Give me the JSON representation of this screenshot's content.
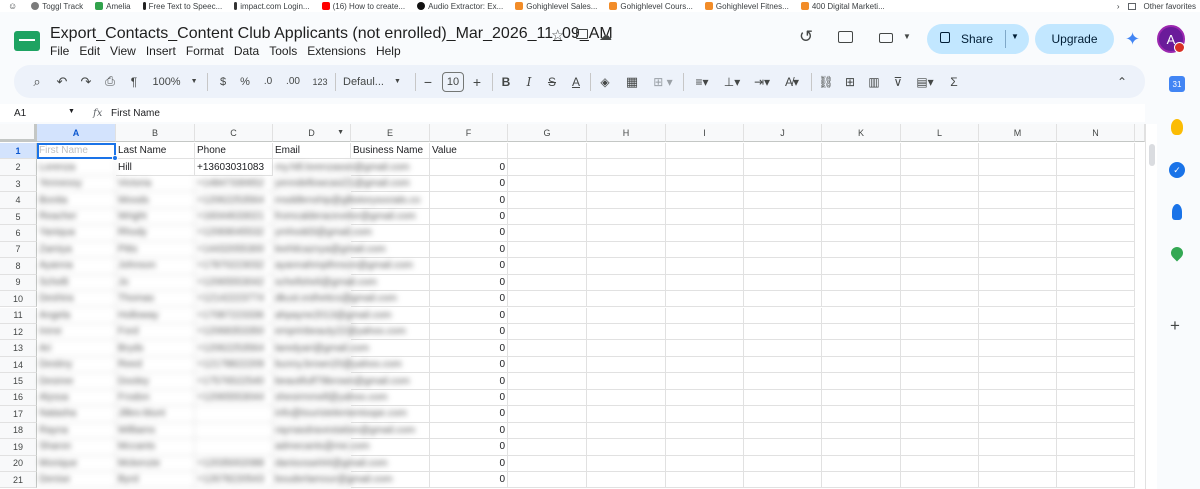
{
  "bookmarks": {
    "items": [
      "Toggl Track",
      "Amelia",
      "Free Text to Speec...",
      "impact.com Login...",
      "(16) How to create...",
      "Audio Extractor: Ex...",
      "Gohighlevel Sales...",
      "Gohighlevel Cours...",
      "Gohighlevel Fitnes...",
      "400 Digital Marketi..."
    ],
    "other_label": "Other favorites"
  },
  "doc": {
    "title": "Export_Contacts_Content Club Applicants (not enrolled)_Mar_2026_11_09_AM"
  },
  "menu": [
    "File",
    "Edit",
    "View",
    "Insert",
    "Format",
    "Data",
    "Tools",
    "Extensions",
    "Help"
  ],
  "header": {
    "share_label": "Share",
    "upgrade_label": "Upgrade",
    "avatar_letter": "A"
  },
  "toolbar": {
    "zoom": "100%",
    "currency": "$",
    "percent": "%",
    "dec_decrease": ".0",
    "dec_increase": ".00",
    "number_format": "123",
    "font": "Defaul...",
    "font_size": "10",
    "bold": "B",
    "italic": "I",
    "strike": "S",
    "text_color": "A",
    "functions": "Σ"
  },
  "formula_bar": {
    "cell_ref": "A1",
    "fx": "fx",
    "value": "First Name"
  },
  "columns": [
    "A",
    "B",
    "C",
    "D",
    "E",
    "F",
    "G",
    "H",
    "I",
    "J",
    "K",
    "L",
    "M",
    "N"
  ],
  "rows": [
    "1",
    "2",
    "3",
    "4",
    "5",
    "6",
    "7",
    "8",
    "9",
    "10",
    "11",
    "12",
    "13",
    "14",
    "15",
    "16",
    "17",
    "18",
    "19",
    "20",
    "21"
  ],
  "headers": [
    "First Name",
    "Last Name",
    "Phone",
    "Email",
    "Business Name",
    "Value"
  ],
  "table": [
    [
      "Lorenza",
      "Hill",
      "+13603031083",
      "my.hill.lorenzassn@gmail.com",
      "",
      "0"
    ],
    [
      "Yennessy",
      "Victoria",
      "+14847330652",
      "yenndellowcasi21@gmail.com",
      "",
      "0"
    ],
    [
      "Bonita",
      "Woods",
      "+12062253564",
      "msddlenship@glbstorysocials.co",
      "",
      "0"
    ],
    [
      "Reacher",
      "Wright",
      "+16044633021",
      "fromcalderacevelor@gmail.com",
      "",
      "0"
    ],
    [
      "Yaniqua",
      "Rhody",
      "+12069045532",
      "ymhodd3@gmail.com",
      "",
      "0"
    ],
    [
      "Zamiya",
      "Pitts",
      "+14432055300",
      "leehilcaznya@gmail.com",
      "",
      "0"
    ],
    [
      "Ayanna",
      "Johnson",
      "+17870223032",
      "ayannahmpthnson@gmail.com",
      "",
      "0"
    ],
    [
      "Schelli",
      "Jo",
      "+12065553042",
      "schellsheli@gmail.com",
      "",
      "0"
    ],
    [
      "Deshira",
      "Thomas",
      "+12142223774",
      "dkust.esthetics@gmail.com",
      "",
      "0"
    ],
    [
      "Angela",
      "Holloway",
      "+17087223336",
      "ahpayne2013@gmail.com",
      "",
      "0"
    ],
    [
      "Irene",
      "Ford",
      "+12068353350",
      "emprinbeauty22@yahoo.com",
      "",
      "0"
    ],
    [
      "Ari",
      "Bryds",
      "+12062253564",
      "laredyari@gmail.com",
      "",
      "0"
    ],
    [
      "Destiny",
      "Reed",
      "+12178822209",
      "bunny.brown20@yahoo.com",
      "",
      "0"
    ],
    [
      "Desiree",
      "Dooley",
      "+17576522540",
      "beautifulf79brown@gmail.com",
      "",
      "0"
    ],
    [
      "Alyssa",
      "Frodon",
      "+12065553044",
      "shesirmmell@yahoo.com",
      "",
      "0"
    ],
    [
      "Natasha",
      "Jilles-blunt",
      "",
      "info@touristelementsspe.com",
      "",
      "0"
    ],
    [
      "Rayna",
      "Williams",
      "",
      "raynasdravestation@gmail.com",
      "",
      "0"
    ],
    [
      "Sharon",
      "Mccants",
      "",
      "admecants@me.com",
      "",
      "0"
    ],
    [
      "Monique",
      "Mckenzie",
      "+12035002088",
      "danisosa444@gmail.com",
      "",
      "0"
    ],
    [
      "Denise",
      "Byrd",
      "+12678220543",
      "bouderlamour@gmail.com",
      "",
      "0"
    ]
  ]
}
